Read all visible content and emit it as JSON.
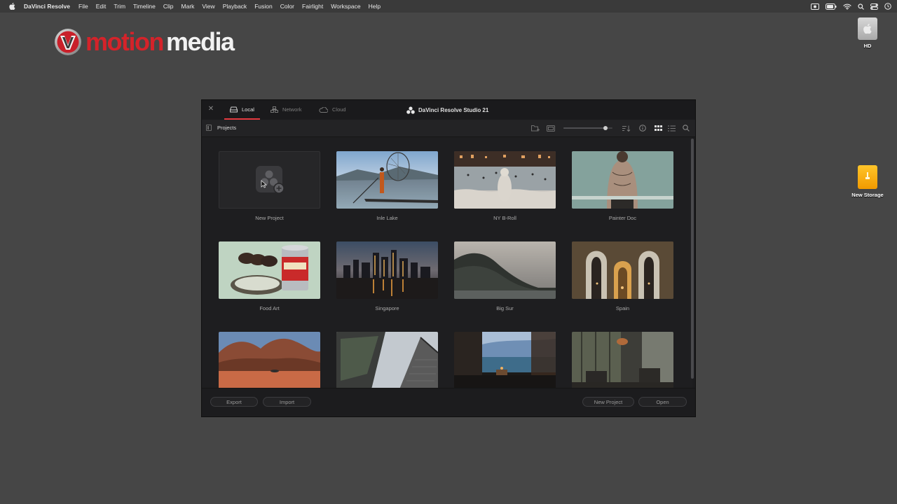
{
  "menubar": {
    "app_name": "DaVinci Resolve",
    "items": [
      "File",
      "Edit",
      "Trim",
      "Timeline",
      "Clip",
      "Mark",
      "View",
      "Playback",
      "Fusion",
      "Color",
      "Fairlight",
      "Workspace",
      "Help"
    ],
    "status_icons": [
      "screen-record-icon",
      "battery-icon",
      "wifi-icon",
      "search-icon",
      "control-center-icon",
      "clock-icon"
    ]
  },
  "logo": {
    "part1": "motion",
    "part2": "media",
    "accent": "#d4232a"
  },
  "desktop": {
    "hd_label": "HD",
    "storage_label": "New Storage"
  },
  "window": {
    "title": "DaVinci Resolve Studio 21",
    "tabs": [
      {
        "label": "Local",
        "icon": "drive-icon",
        "active": true
      },
      {
        "label": "Network",
        "icon": "network-icon",
        "active": false
      },
      {
        "label": "Cloud",
        "icon": "cloud-icon",
        "active": false
      }
    ],
    "breadcrumb": "Projects",
    "thumbnail_size": 0.85,
    "view_mode": "grid",
    "projects": [
      {
        "name": "New Project"
      },
      {
        "name": "Inle Lake"
      },
      {
        "name": "NY B-Roll"
      },
      {
        "name": "Painter Doc"
      },
      {
        "name": "Food Art"
      },
      {
        "name": "Singapore"
      },
      {
        "name": "Big Sur"
      },
      {
        "name": "Spain"
      },
      {
        "name": ""
      },
      {
        "name": ""
      },
      {
        "name": ""
      },
      {
        "name": ""
      }
    ],
    "footer": {
      "export_label": "Export",
      "import_label": "Import",
      "new_project_label": "New Project",
      "open_label": "Open"
    },
    "accent_color": "#e5393f"
  }
}
